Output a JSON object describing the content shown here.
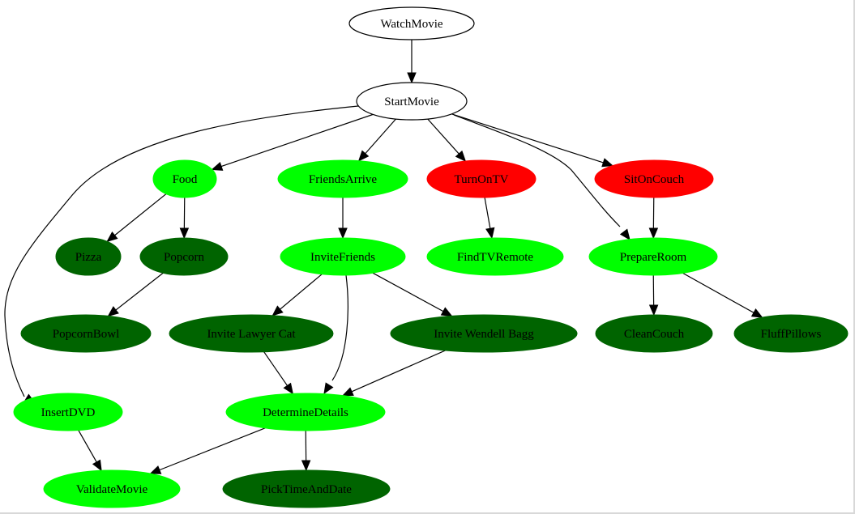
{
  "graph": {
    "colors": {
      "default_fill": "#ffffff",
      "default_stroke": "#000000",
      "bright_green": "#00ff00",
      "dark_green": "#006400",
      "red": "#ff0000"
    },
    "nodes": [
      {
        "id": "WatchMovie",
        "label": "WatchMovie",
        "style": "outline"
      },
      {
        "id": "StartMovie",
        "label": "StartMovie",
        "style": "outline"
      },
      {
        "id": "Food",
        "label": "Food",
        "style": "bright_green"
      },
      {
        "id": "FriendsArrive",
        "label": "FriendsArrive",
        "style": "bright_green"
      },
      {
        "id": "TurnOnTV",
        "label": "TurnOnTV",
        "style": "red"
      },
      {
        "id": "SitOnCouch",
        "label": "SitOnCouch",
        "style": "red"
      },
      {
        "id": "Pizza",
        "label": "Pizza",
        "style": "dark_green"
      },
      {
        "id": "Popcorn",
        "label": "Popcorn",
        "style": "dark_green"
      },
      {
        "id": "InviteFriends",
        "label": "InviteFriends",
        "style": "bright_green"
      },
      {
        "id": "FindTVRemote",
        "label": "FindTVRemote",
        "style": "bright_green"
      },
      {
        "id": "PrepareRoom",
        "label": "PrepareRoom",
        "style": "bright_green"
      },
      {
        "id": "PopcornBowl",
        "label": "PopcornBowl",
        "style": "dark_green"
      },
      {
        "id": "InviteLawyerCat",
        "label": "Invite Lawyer Cat",
        "style": "dark_green"
      },
      {
        "id": "InviteWendellBagg",
        "label": "Invite Wendell Bagg",
        "style": "dark_green"
      },
      {
        "id": "CleanCouch",
        "label": "CleanCouch",
        "style": "dark_green"
      },
      {
        "id": "FluffPillows",
        "label": "FluffPillows",
        "style": "dark_green"
      },
      {
        "id": "InsertDVD",
        "label": "InsertDVD",
        "style": "bright_green"
      },
      {
        "id": "DetermineDetails",
        "label": "DetermineDetails",
        "style": "bright_green"
      },
      {
        "id": "ValidateMovie",
        "label": "ValidateMovie",
        "style": "bright_green"
      },
      {
        "id": "PickTimeAndDate",
        "label": "PickTimeAndDate",
        "style": "dark_green"
      }
    ],
    "edges": [
      {
        "from": "WatchMovie",
        "to": "StartMovie"
      },
      {
        "from": "StartMovie",
        "to": "Food"
      },
      {
        "from": "StartMovie",
        "to": "FriendsArrive"
      },
      {
        "from": "StartMovie",
        "to": "TurnOnTV"
      },
      {
        "from": "StartMovie",
        "to": "SitOnCouch"
      },
      {
        "from": "StartMovie",
        "to": "PrepareRoom"
      },
      {
        "from": "StartMovie",
        "to": "InsertDVD"
      },
      {
        "from": "Food",
        "to": "Pizza"
      },
      {
        "from": "Food",
        "to": "Popcorn"
      },
      {
        "from": "Popcorn",
        "to": "PopcornBowl"
      },
      {
        "from": "FriendsArrive",
        "to": "InviteFriends"
      },
      {
        "from": "InviteFriends",
        "to": "InviteLawyerCat"
      },
      {
        "from": "InviteFriends",
        "to": "DetermineDetails"
      },
      {
        "from": "InviteFriends",
        "to": "InviteWendellBagg"
      },
      {
        "from": "TurnOnTV",
        "to": "FindTVRemote"
      },
      {
        "from": "SitOnCouch",
        "to": "PrepareRoom"
      },
      {
        "from": "PrepareRoom",
        "to": "CleanCouch"
      },
      {
        "from": "PrepareRoom",
        "to": "FluffPillows"
      },
      {
        "from": "InviteLawyerCat",
        "to": "DetermineDetails"
      },
      {
        "from": "InviteWendellBagg",
        "to": "DetermineDetails"
      },
      {
        "from": "InsertDVD",
        "to": "ValidateMovie"
      },
      {
        "from": "DetermineDetails",
        "to": "ValidateMovie"
      },
      {
        "from": "DetermineDetails",
        "to": "PickTimeAndDate"
      }
    ]
  }
}
